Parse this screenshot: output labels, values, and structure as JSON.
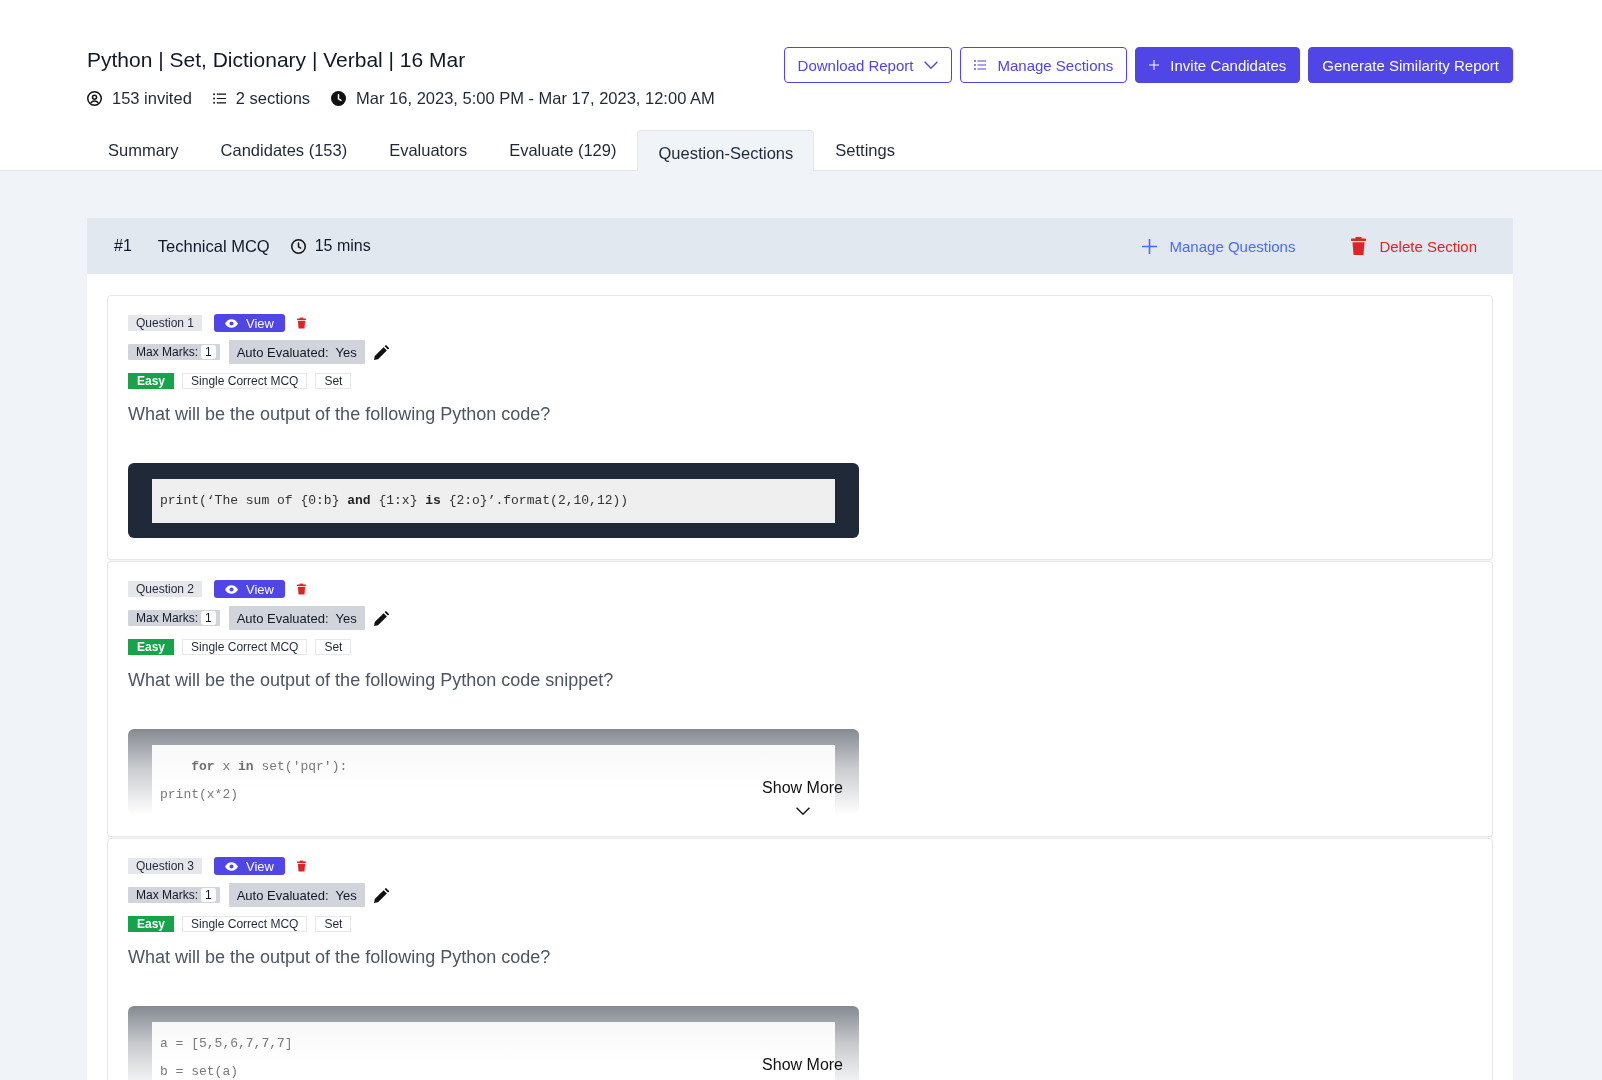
{
  "header": {
    "title": "Python | Set, Dictionary | Verbal | 16 Mar",
    "meta": [
      {
        "kind": "invited",
        "text": "153 invited"
      },
      {
        "kind": "sections",
        "text": "2 sections"
      },
      {
        "kind": "schedule",
        "text": "Mar 16, 2023, 5:00 PM - Mar 17, 2023, 12:00 AM"
      }
    ]
  },
  "actions": [
    {
      "kind": "dropdown",
      "label": "Download Report"
    },
    {
      "kind": "manage",
      "label": "Manage Sections"
    },
    {
      "kind": "invite",
      "label": "Invite Candidates"
    },
    {
      "kind": "report",
      "label": "Generate Similarity Report"
    }
  ],
  "tabs": [
    {
      "label": "Summary",
      "selected": false
    },
    {
      "label": "Candidates (153)",
      "selected": false
    },
    {
      "label": "Evaluators",
      "selected": false
    },
    {
      "label": "Evaluate (129)",
      "selected": false
    },
    {
      "label": "Question-Sections",
      "selected": true
    },
    {
      "label": "Settings",
      "selected": false
    }
  ],
  "section": {
    "number": "#1",
    "title": "Technical MCQ",
    "duration": "15 mins",
    "actions": [
      {
        "kind": "add",
        "label": "Manage Questions"
      },
      {
        "kind": "delete",
        "label": "Delete Section"
      }
    ]
  },
  "questions": [
    {
      "label": "Question 1",
      "view": "View",
      "max_marks_label": "Max Marks:",
      "max_marks": "1",
      "auto_evaluated": "Auto Evaluated:  Yes",
      "tags": [
        {
          "kind": "difficulty",
          "text": "Easy"
        },
        {
          "kind": "type",
          "text": "Single Correct MCQ"
        },
        {
          "kind": "topic",
          "text": "Set"
        }
      ],
      "text": "What will be the output of the following Python code?",
      "code": [
        "print(‘The sum of {0:b} **and** {1:x} **is** {2:o}’.format(2,10,12))"
      ],
      "expanded": true
    },
    {
      "label": "Question 2",
      "view": "View",
      "max_marks_label": "Max Marks:",
      "max_marks": "1",
      "auto_evaluated": "Auto Evaluated:  Yes",
      "tags": [
        {
          "kind": "difficulty",
          "text": "Easy"
        },
        {
          "kind": "type",
          "text": "Single Correct MCQ"
        },
        {
          "kind": "topic",
          "text": "Set"
        }
      ],
      "text": "What will be the output of the following Python code snippet?",
      "code": [
        "    **for** x **in** set('pqr'):",
        "print(x*2)"
      ],
      "expanded": false,
      "show_more": "Show More"
    },
    {
      "label": "Question 3",
      "view": "View",
      "max_marks_label": "Max Marks:",
      "max_marks": "1",
      "auto_evaluated": "Auto Evaluated:  Yes",
      "tags": [
        {
          "kind": "difficulty",
          "text": "Easy"
        },
        {
          "kind": "type",
          "text": "Single Correct MCQ"
        },
        {
          "kind": "topic",
          "text": "Set"
        }
      ],
      "text": "What will be the output of the following Python code?",
      "code": [
        "a = [5,5,6,7,7,7]",
        "b = set(a)"
      ],
      "expanded": false,
      "show_more": "Show More"
    }
  ]
}
